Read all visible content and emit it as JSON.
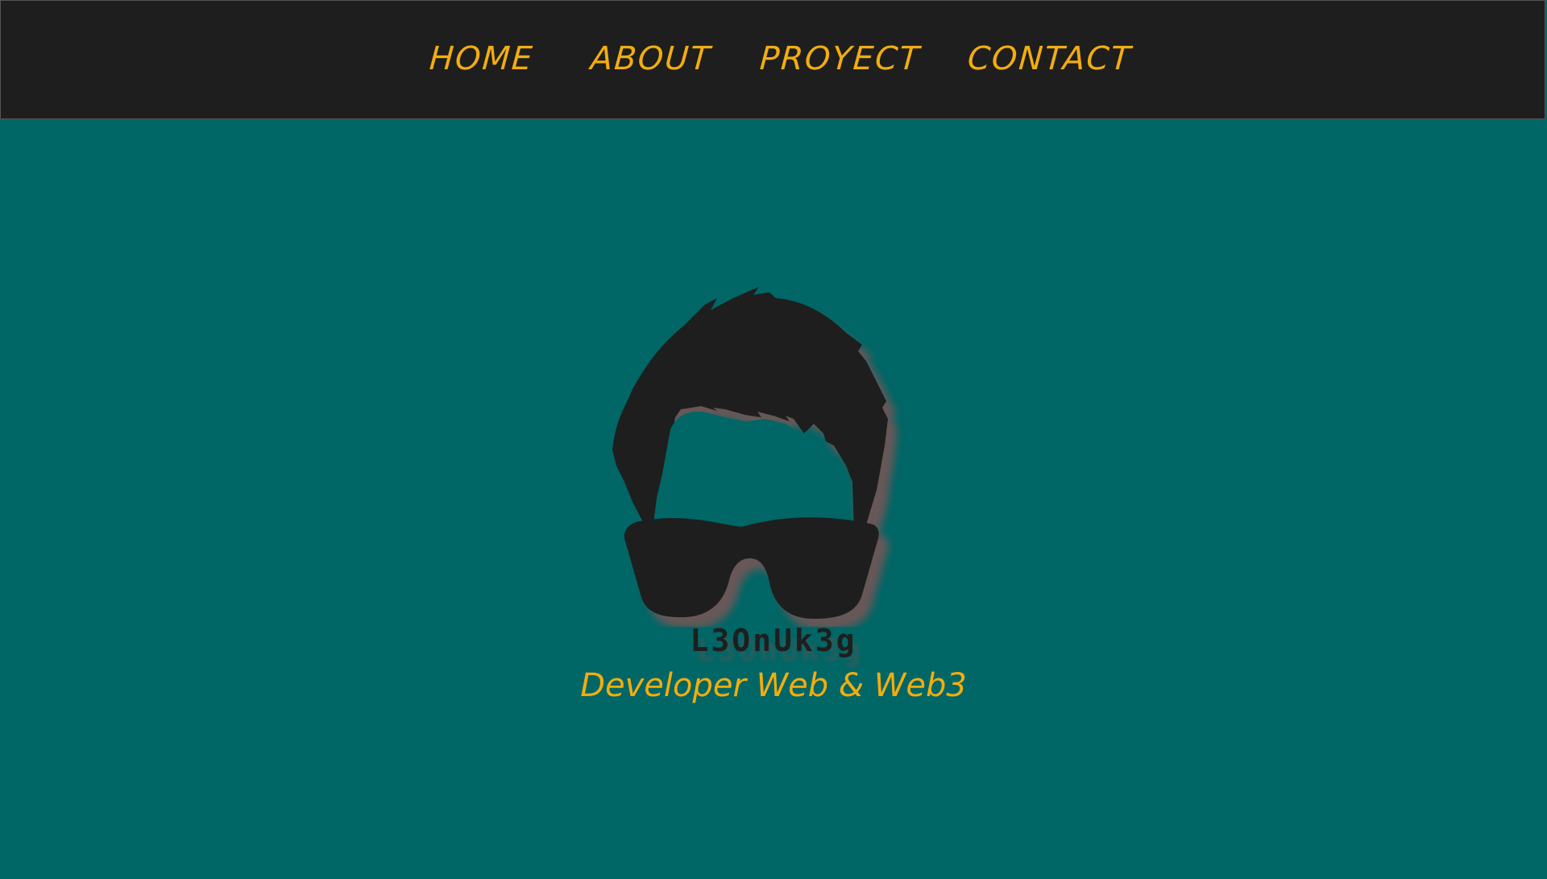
{
  "nav": {
    "items": [
      {
        "label": "HOME"
      },
      {
        "label": "ABOUT"
      },
      {
        "label": "PROYECT"
      },
      {
        "label": "CONTACT"
      }
    ]
  },
  "hero": {
    "logo_text": "L3OnUk3g",
    "tagline": "Developer Web & Web3"
  },
  "colors": {
    "background": "#006666",
    "navbar": "#1e1e1e",
    "accent": "#f2ad0f",
    "logo": "#1e1e1e",
    "shadow": "#7a5555"
  },
  "icons": {
    "avatar": "avatar-hair-sunglasses-icon"
  }
}
